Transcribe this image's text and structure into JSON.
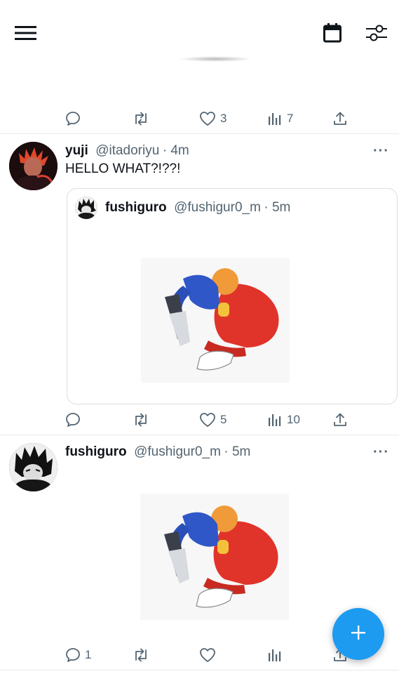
{
  "tweet_top": {
    "likes": "3",
    "views": "7"
  },
  "tweet_reply": {
    "name": "yuji",
    "handle": "@itadoriyu",
    "time": "· 4m",
    "text": "HELLO WHAT?!??!",
    "quote": {
      "name": "fushiguro",
      "handle": "@fushigur0_m",
      "time": "· 5m"
    },
    "likes": "5",
    "views": "10"
  },
  "tweet_original": {
    "name": "fushiguro",
    "handle": "@fushigur0_m",
    "time": "· 5m",
    "replies": "1"
  },
  "icons": {
    "menu": "hamburger-menu-icon",
    "calendar": "calendar-icon",
    "filter": "sliders-icon",
    "reply": "speech-bubble-icon",
    "retweet": "retweet-icon",
    "like": "heart-icon",
    "views": "bar-chart-icon",
    "share": "share-icon",
    "compose": "plus-icon"
  },
  "colors": {
    "accent": "#1d9bf0",
    "muted": "#536471",
    "text": "#0f1419"
  }
}
